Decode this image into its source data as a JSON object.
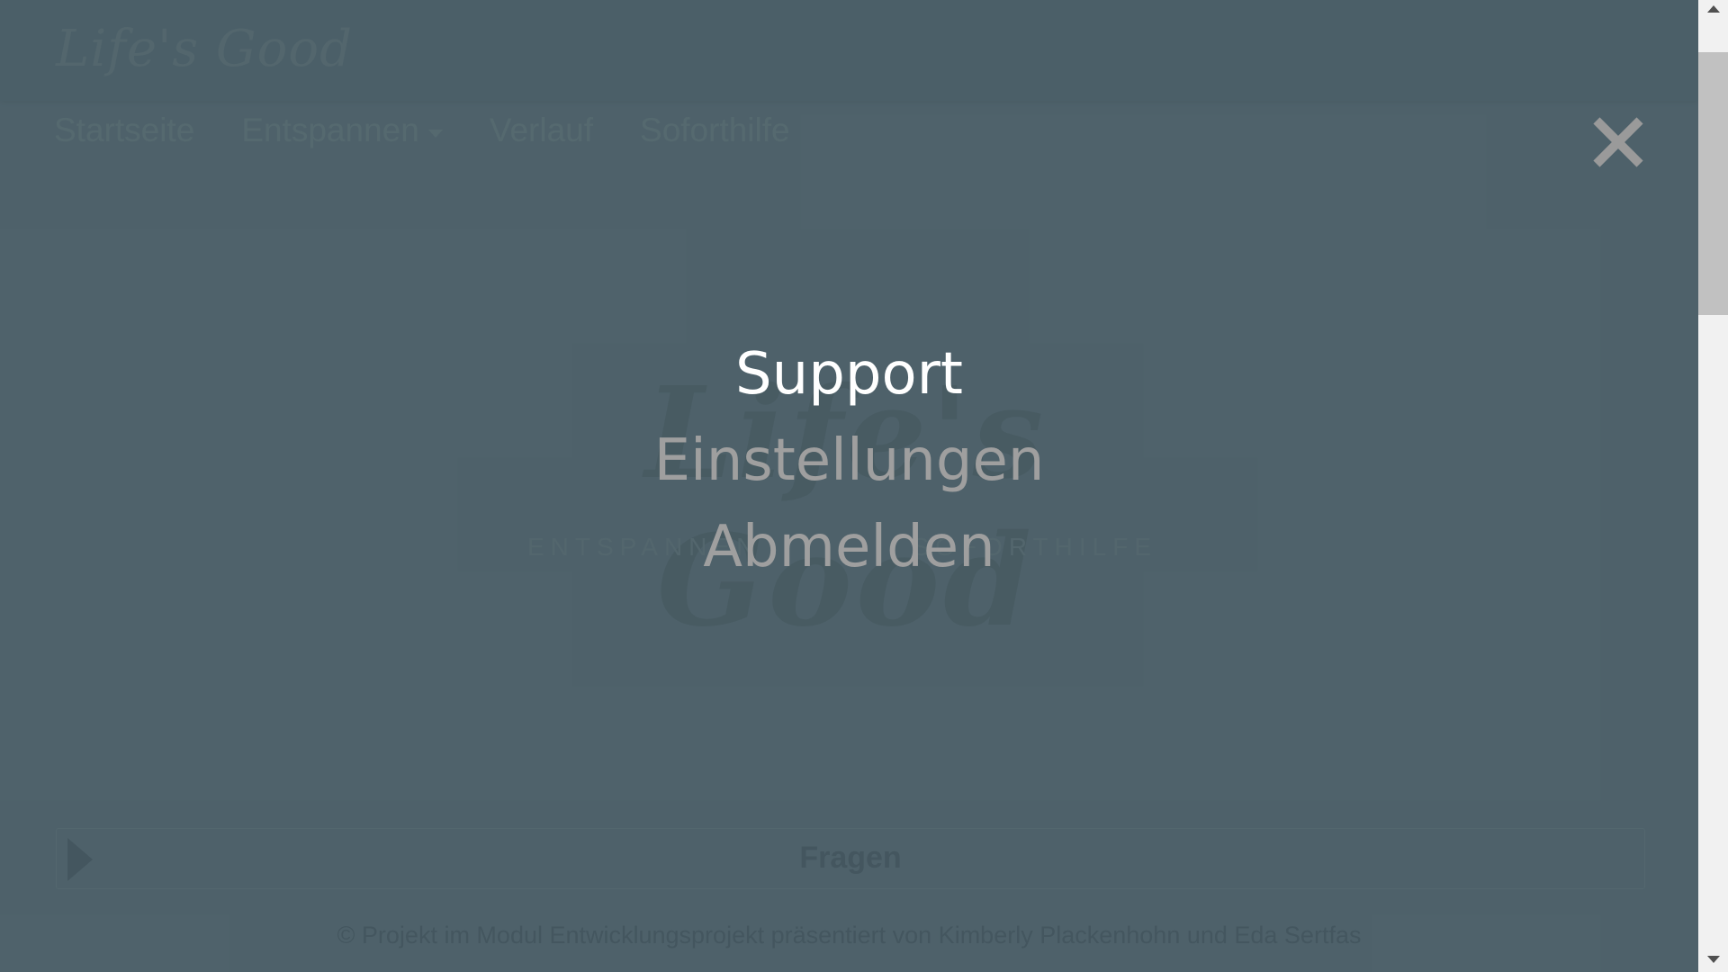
{
  "brand": "Life's Good",
  "nav": {
    "items": [
      "Startseite",
      "Entspannen",
      "Verlauf",
      "Soforthilfe"
    ]
  },
  "hero": {
    "logo": "Life's Good",
    "tagline_left": "ENTSPANNEN",
    "tagline_right": "SOFORTHILFE"
  },
  "questions": {
    "label": "Fragen"
  },
  "footer": {
    "text": "© Projekt im Modul Entwicklungsprojekt präsentiert von Kimberly Plackenhohn und Eda Sertfas"
  },
  "overlay_menu": {
    "items": [
      "Support",
      "Einstellungen",
      "Abmelden"
    ],
    "active_item": "Support"
  },
  "colors": {
    "overlay_bg": "#4e626b",
    "menu_active": "#ffffff",
    "menu_inactive": "#9f9f9f",
    "close_icon": "#9a9a9a"
  }
}
